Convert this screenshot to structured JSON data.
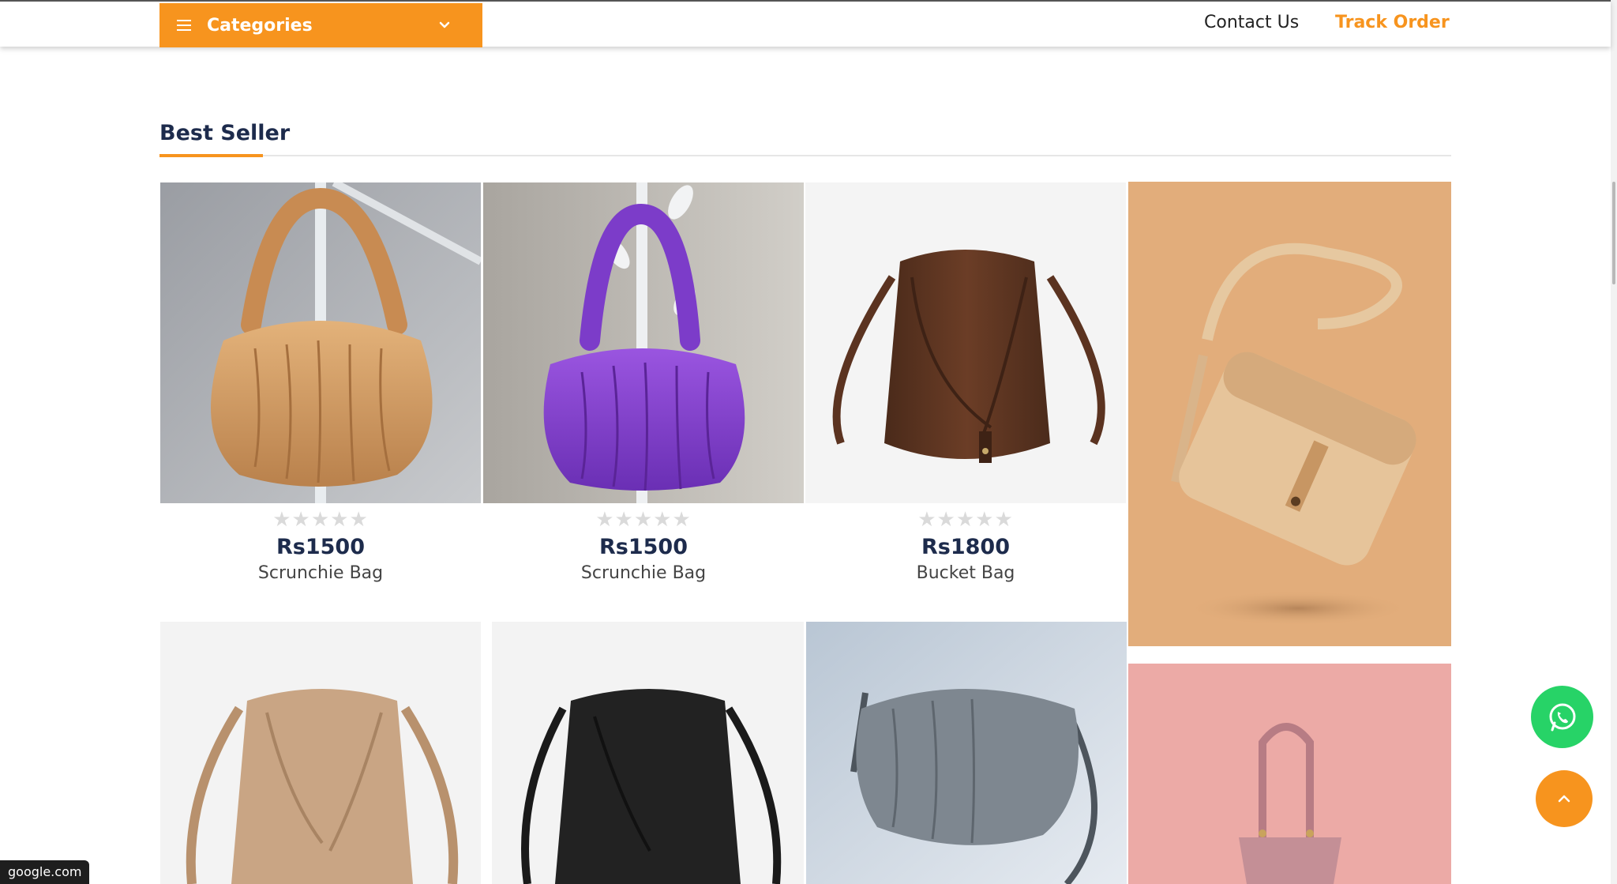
{
  "header": {
    "categories_label": "Categories",
    "nav": {
      "contact": "Contact Us",
      "track": "Track Order"
    }
  },
  "section": {
    "title": "Best Seller"
  },
  "products": [
    {
      "stars": "★★★★★",
      "price": "Rs1500",
      "name": "Scrunchie Bag",
      "color": "#d4a06a"
    },
    {
      "stars": "★★★★★",
      "price": "Rs1500",
      "name": "Scrunchie Bag",
      "color": "#7b3ec9"
    },
    {
      "stars": "★★★★★",
      "price": "Rs1800",
      "name": "Bucket Bag",
      "color": "#5a3322"
    }
  ],
  "status_bar": {
    "hover_url": "google.com"
  },
  "colors": {
    "accent": "#f7941e",
    "title": "#1d2b4c",
    "whatsapp": "#27d367"
  },
  "icons": [
    "menu-icon",
    "chevron-down-icon",
    "whatsapp-icon",
    "chevron-up-icon"
  ]
}
